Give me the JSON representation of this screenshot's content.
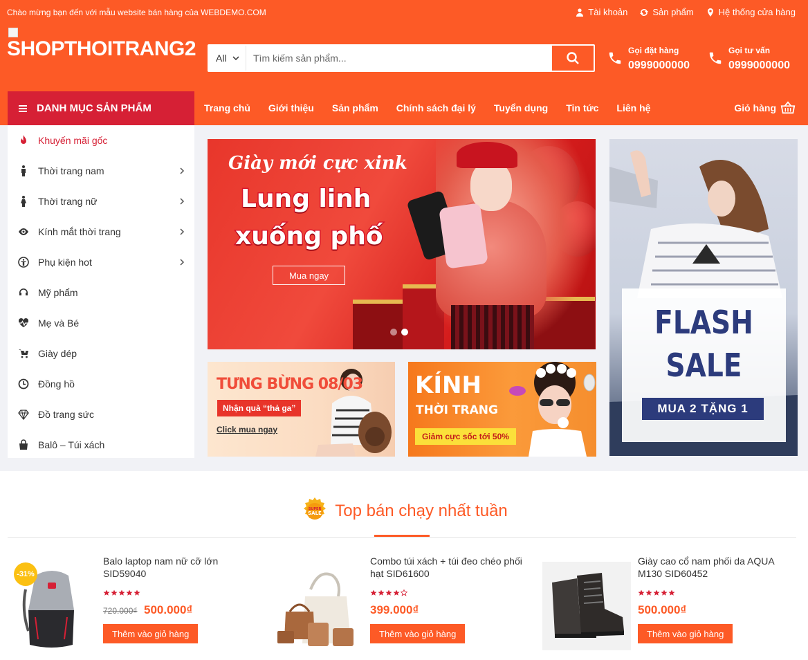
{
  "topbar": {
    "welcome": "Chào mừng bạn đến với mẫu website bán hàng của WEBDEMO.COM",
    "links": [
      {
        "label": "Tài khoản",
        "icon": "user-icon"
      },
      {
        "label": "Sản phẩm",
        "icon": "refresh-icon"
      },
      {
        "label": "Hệ thống cửa hàng",
        "icon": "map-pin-icon"
      }
    ]
  },
  "logo": {
    "text": "SHOPTHOITRANG2"
  },
  "search": {
    "category": "All",
    "placeholder": "Tìm kiếm sản phẩm..."
  },
  "hotlines": [
    {
      "label": "Gọi đặt hàng",
      "number": "0999000000"
    },
    {
      "label": "Gọi tư vấn",
      "number": "0999000000"
    }
  ],
  "nav": {
    "category_button": "DANH MỤC SẢN PHẨM",
    "items": [
      "Trang chủ",
      "Giới thiệu",
      "Sản phẩm",
      "Chính sách đại lý",
      "Tuyển dụng",
      "Tin tức",
      "Liên hệ"
    ],
    "cart": "Giỏ hàng"
  },
  "sidebar": {
    "items": [
      {
        "label": "Khuyến mãi gốc",
        "icon": "fire-icon",
        "submenu": false
      },
      {
        "label": "Thời trang nam",
        "icon": "male-icon",
        "submenu": true
      },
      {
        "label": "Thời trang nữ",
        "icon": "female-icon",
        "submenu": true
      },
      {
        "label": "Kính mắt thời trang",
        "icon": "eye-icon",
        "submenu": true
      },
      {
        "label": "Phụ kiện hot",
        "icon": "accessibility-icon",
        "submenu": true
      },
      {
        "label": "Mỹ phẩm",
        "icon": "headset-icon",
        "submenu": false
      },
      {
        "label": "Mẹ và Bé",
        "icon": "heartbeat-icon",
        "submenu": false
      },
      {
        "label": "Giày dép",
        "icon": "cart-plus-icon",
        "submenu": false
      },
      {
        "label": "Đồng hồ",
        "icon": "clock-icon",
        "submenu": false
      },
      {
        "label": "Đồ trang sức",
        "icon": "diamond-icon",
        "submenu": false
      },
      {
        "label": "Balô – Túi xách",
        "icon": "shopping-bag-icon",
        "submenu": false
      }
    ]
  },
  "slider": {
    "line1": "Giày mới cực xink",
    "line2": "Lung linh",
    "line3": "xuống phố",
    "cta": "Mua ngay",
    "slide_count": 2,
    "active_slide": 2
  },
  "banner_left": {
    "title": "TƯNG BỪNG 08/03",
    "tag": "Nhận quà “thả ga”",
    "link": "Click mua ngay"
  },
  "banner_mid": {
    "title": "KÍNH",
    "subtitle": "THỜI TRANG",
    "tag": "Giảm cực sốc tới 50%"
  },
  "banner_right": {
    "line1": "FLASH",
    "line2": "SALE",
    "strip": "MUA 2 TẶNG 1"
  },
  "section": {
    "title": "Top bán chạy nhất tuần",
    "seal": "SUPER SALE"
  },
  "products": [
    {
      "name": "Balo laptop nam nữ cỡ lớn SID59040",
      "rating": 5,
      "old_price": "720.000₫",
      "price": "500.000₫",
      "badge": "-31%",
      "button": "Thêm vào giỏ hàng"
    },
    {
      "name": "Combo túi xách + túi đeo chéo phối hạt SID61600",
      "rating": 4,
      "old_price": "",
      "price": "399.000₫",
      "badge": "",
      "button": "Thêm vào giỏ hàng"
    },
    {
      "name": "Giày cao cổ nam phối da AQUA M130 SID60452",
      "rating": 5,
      "old_price": "",
      "price": "500.000₫",
      "badge": "",
      "button": "Thêm vào giỏ hàng"
    }
  ],
  "colors": {
    "brand": "#fd5a26",
    "category_red": "#d62035",
    "price": "#fd5a26",
    "star": "#d62035"
  }
}
